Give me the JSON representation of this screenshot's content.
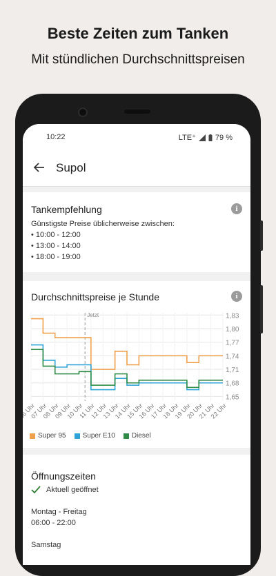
{
  "promo": {
    "headline": "Beste Zeiten zum Tanken",
    "subline": "Mit stündlichen Durchschnittspreisen"
  },
  "status": {
    "time": "10:22",
    "network": "LTE⁺",
    "battery": "79 %"
  },
  "appbar": {
    "title": "Supol"
  },
  "recommendation": {
    "title": "Tankempfehlung",
    "subtitle": "Günstigste Preise üblicherweise zwischen:",
    "items": [
      "• 10:00 - 12:00",
      "• 13:00 - 14:00",
      "• 18:00 - 19:00"
    ]
  },
  "chart_section": {
    "title": "Durchschnittspreise je Stunde",
    "now_label": "Jetzt"
  },
  "chart_data": {
    "type": "line",
    "step": true,
    "x": [
      "06 Uhr",
      "07 Uhr",
      "08 Uhr",
      "09 Uhr",
      "10 Uhr",
      "11 Uhr",
      "12 Uhr",
      "13 Uhr",
      "14 Uhr",
      "15 Uhr",
      "16 Uhr",
      "17 Uhr",
      "18 Uhr",
      "19 Uhr",
      "20 Uhr",
      "21 Uhr",
      "22 Uhr"
    ],
    "y_ticks": [
      "1,83",
      "1,80",
      "1,77",
      "1,74",
      "1,71",
      "1,68",
      "1,65"
    ],
    "ylim": [
      1.64,
      1.835
    ],
    "now_index": 4.5,
    "series": [
      {
        "name": "Super 95",
        "color": "#f0a04b",
        "values": [
          1.822,
          1.79,
          1.78,
          1.78,
          1.78,
          1.71,
          1.71,
          1.75,
          1.72,
          1.74,
          1.74,
          1.74,
          1.74,
          1.725,
          1.74,
          1.74,
          1.74
        ]
      },
      {
        "name": "Super E10",
        "color": "#2ea3d8",
        "values": [
          1.764,
          1.73,
          1.715,
          1.72,
          1.72,
          1.665,
          1.665,
          1.69,
          1.675,
          1.68,
          1.68,
          1.68,
          1.68,
          1.665,
          1.68,
          1.68,
          1.68
        ]
      },
      {
        "name": "Diesel",
        "color": "#2e8b46",
        "values": [
          1.754,
          1.717,
          1.7,
          1.7,
          1.705,
          1.675,
          1.675,
          1.7,
          1.68,
          1.686,
          1.686,
          1.686,
          1.686,
          1.67,
          1.686,
          1.686,
          1.686
        ]
      }
    ]
  },
  "hours": {
    "title": "Öffnungszeiten",
    "status": "Aktuell geöffnet",
    "weekday_label": "Montag - Freitag",
    "weekday_hours": "06:00 - 22:00",
    "saturday_label": "Samstag"
  },
  "colors": {
    "check": "#2e7d32",
    "info": "#9b9b9b"
  }
}
